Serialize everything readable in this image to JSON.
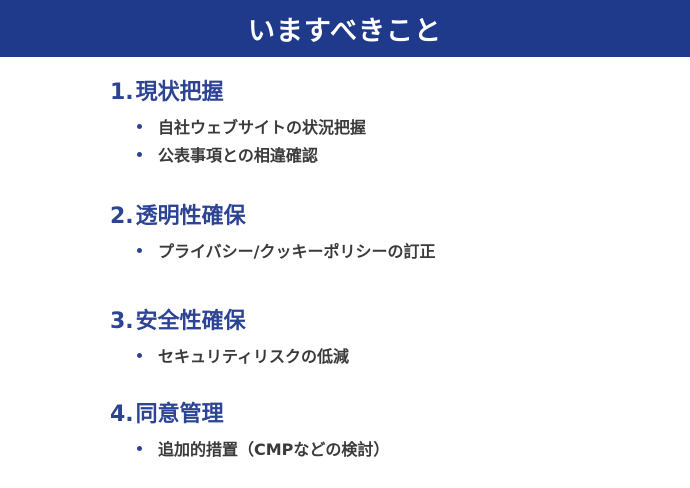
{
  "header": {
    "title": "いますべきこと"
  },
  "sections": [
    {
      "number": "1.",
      "title": "現状把握",
      "items": [
        "自社ウェブサイトの状況把握",
        "公表事項との相違確認"
      ]
    },
    {
      "number": "2.",
      "title": "透明性確保",
      "items": [
        "プライバシー/クッキーポリシーの訂正"
      ]
    },
    {
      "number": "3.",
      "title": "安全性確保",
      "items": [
        "セキュリティリスクの低減"
      ]
    },
    {
      "number": "4.",
      "title": "同意管理",
      "items": [
        "追加的措置（CMPなどの検討）"
      ]
    }
  ],
  "colors": {
    "header_bg": "#1f3a8a",
    "heading": "#2d4494",
    "body_text": "#3a3a3a"
  }
}
